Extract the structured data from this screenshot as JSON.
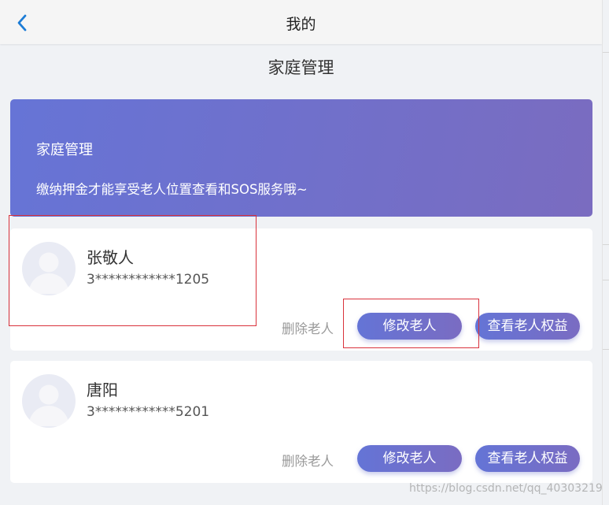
{
  "header": {
    "title": "我的",
    "back_icon": "chevron-left-icon"
  },
  "page_title": "家庭管理",
  "banner": {
    "title": "家庭管理",
    "subtitle": "缴纳押金才能享受老人位置查看和SOS服务哦~",
    "gradient_start": "#6674d6",
    "gradient_end": "#7a6cc0"
  },
  "members": [
    {
      "name": "张敬人",
      "phone": "3************1205",
      "delete_label": "删除老人",
      "edit_label": "修改老人",
      "rights_label": "查看老人权益"
    },
    {
      "name": "唐阳",
      "phone": "3************5201",
      "delete_label": "删除老人",
      "edit_label": "修改老人",
      "rights_label": "查看老人权益"
    }
  ],
  "watermark": "https://blog.csdn.net/qq_40303219",
  "colors": {
    "accent": "#1c7cd6",
    "button": "#6a72cf",
    "highlight_box": "#d9323c"
  }
}
